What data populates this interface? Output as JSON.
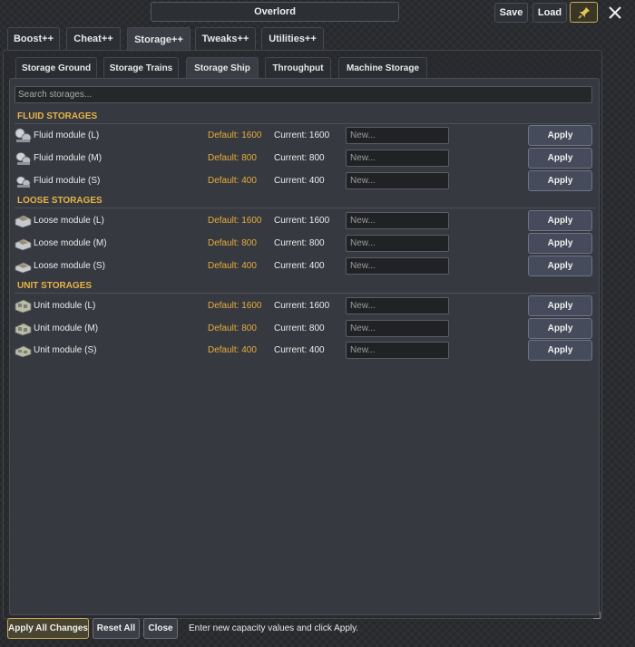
{
  "window": {
    "title": "Overlord",
    "save_label": "Save",
    "load_label": "Load",
    "pin_icon": "pin-icon",
    "close_icon": "close-icon"
  },
  "top_tabs": [
    {
      "label": "Boost++"
    },
    {
      "label": "Cheat++"
    },
    {
      "label": "Storage++",
      "active": true
    },
    {
      "label": "Tweaks++"
    },
    {
      "label": "Utilities++"
    }
  ],
  "sub_tabs": [
    {
      "label": "Storage Ground"
    },
    {
      "label": "Storage Trains"
    },
    {
      "label": "Storage Ship",
      "active": true
    },
    {
      "label": "Throughput"
    },
    {
      "label": "Machine Storage"
    }
  ],
  "search": {
    "placeholder": "Search storages..."
  },
  "sections": [
    {
      "title": "FLUID STORAGES",
      "rows": [
        {
          "name": "Fluid module (L)",
          "default": "Default: 1600",
          "current": "Current: 1600",
          "placeholder": "New...",
          "apply": "Apply",
          "icon": "fluid-module-icon"
        },
        {
          "name": "Fluid module (M)",
          "default": "Default: 800",
          "current": "Current: 800",
          "placeholder": "New...",
          "apply": "Apply",
          "icon": "fluid-module-icon"
        },
        {
          "name": "Fluid module (S)",
          "default": "Default: 400",
          "current": "Current: 400",
          "placeholder": "New...",
          "apply": "Apply",
          "icon": "fluid-module-icon"
        }
      ]
    },
    {
      "title": "LOOSE STORAGES",
      "rows": [
        {
          "name": "Loose module (L)",
          "default": "Default: 1600",
          "current": "Current: 1600",
          "placeholder": "New...",
          "apply": "Apply",
          "icon": "loose-module-icon"
        },
        {
          "name": "Loose module (M)",
          "default": "Default: 800",
          "current": "Current: 800",
          "placeholder": "New...",
          "apply": "Apply",
          "icon": "loose-module-icon"
        },
        {
          "name": "Loose module (S)",
          "default": "Default: 400",
          "current": "Current: 400",
          "placeholder": "New...",
          "apply": "Apply",
          "icon": "loose-module-icon"
        }
      ]
    },
    {
      "title": "UNIT STORAGES",
      "rows": [
        {
          "name": "Unit module (L)",
          "default": "Default: 1600",
          "current": "Current: 1600",
          "placeholder": "New...",
          "apply": "Apply",
          "icon": "unit-module-icon"
        },
        {
          "name": "Unit module (M)",
          "default": "Default: 800",
          "current": "Current: 800",
          "placeholder": "New...",
          "apply": "Apply",
          "icon": "unit-module-icon"
        },
        {
          "name": "Unit module (S)",
          "default": "Default: 400",
          "current": "Current: 400",
          "placeholder": "New...",
          "apply": "Apply",
          "icon": "unit-module-icon"
        }
      ]
    }
  ],
  "footer": {
    "apply_all_label": "Apply All Changes",
    "reset_all_label": "Reset All",
    "close_label": "Close",
    "hint": "Enter new capacity values and click Apply."
  },
  "colors": {
    "accent_gold": "#e8ae3a",
    "apply_button": "#454b5a",
    "panel": "#363940"
  }
}
